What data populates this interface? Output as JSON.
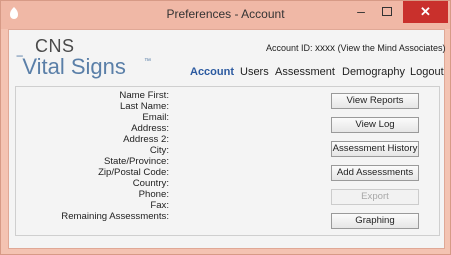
{
  "window": {
    "title": "Preferences - Account",
    "controls": {
      "minimize": "–",
      "maximize": "☐",
      "close": "✕"
    }
  },
  "logo": {
    "line1": "CNS",
    "line2": "Vital Signs",
    "tm": "™"
  },
  "account": {
    "label": "Account ID:",
    "value": "xxxx",
    "note": "(View the Mind Associates)"
  },
  "nav": [
    {
      "label": "Account"
    },
    {
      "label": "Users"
    },
    {
      "label": "Assessment"
    },
    {
      "label": "Demography"
    },
    {
      "label": "Logout"
    }
  ],
  "fields": [
    {
      "label": "Name First:"
    },
    {
      "label": "Last Name:"
    },
    {
      "label": "Email:"
    },
    {
      "label": "Address:"
    },
    {
      "label": "Address 2:"
    },
    {
      "label": "City:"
    },
    {
      "label": "State/Province:"
    },
    {
      "label": "Zip/Postal Code:"
    },
    {
      "label": "Country:"
    },
    {
      "label": "Phone:"
    },
    {
      "label": "Fax:"
    },
    {
      "label": "Remaining Assessments:"
    }
  ],
  "buttons": [
    {
      "label": "View Reports",
      "enabled": true
    },
    {
      "label": "View Log",
      "enabled": true
    },
    {
      "label": "Assessment History",
      "enabled": true
    },
    {
      "label": "Add Assessments",
      "enabled": true
    },
    {
      "label": "Export",
      "enabled": false
    },
    {
      "label": "Graphing",
      "enabled": true
    }
  ],
  "colors": {
    "accent": "#2c5aa0",
    "logo": "#5a7fa8",
    "close": "#c9302c",
    "frame": "#f4c3b2"
  }
}
